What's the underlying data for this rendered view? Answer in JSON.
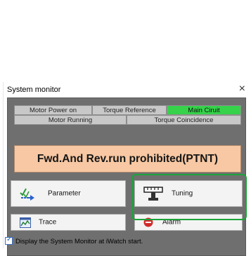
{
  "window": {
    "title": "System monitor",
    "close_glyph": "×"
  },
  "status_row1": [
    {
      "label": "Motor Power on",
      "active": false
    },
    {
      "label": "Torque Reference",
      "active": false
    },
    {
      "label": "Main Ciruit",
      "active": true
    }
  ],
  "status_row2": [
    {
      "label": "Motor Running",
      "active": false
    },
    {
      "label": "Torque Coincidence",
      "active": false
    }
  ],
  "alarm_banner": "Fwd.And Rev.run prohibited(PTNT)",
  "buttons": {
    "parameter": "Parameter",
    "tuning": "Tuning",
    "trace": "Trace",
    "alarm": "Alarm"
  },
  "checkbox": {
    "label": "Display the System Monitor at iWatch start.",
    "checked": true
  },
  "colors": {
    "active_status": "#35d24a",
    "alarm_bg": "#f7c8a3",
    "highlight": "#1ca33a"
  }
}
